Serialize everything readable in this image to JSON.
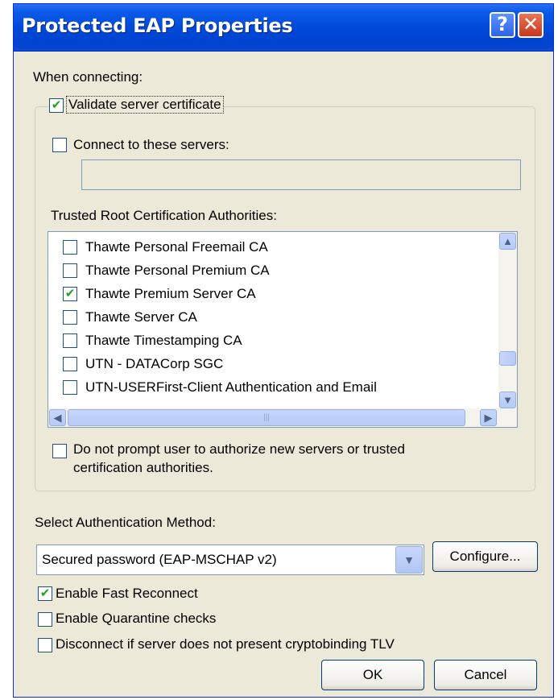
{
  "window": {
    "title": "Protected EAP Properties",
    "help_label": "?",
    "close_label": "✕"
  },
  "when_connecting": {
    "label": "When connecting:",
    "validate_cert": {
      "label": "Validate server certificate",
      "checked": true
    },
    "connect_servers": {
      "label": "Connect to these servers:",
      "checked": false,
      "value": ""
    },
    "trusted_label": "Trusted Root Certification Authorities:",
    "authorities": [
      {
        "name": "Thawte Personal Freemail CA",
        "checked": false
      },
      {
        "name": "Thawte Personal Premium CA",
        "checked": false
      },
      {
        "name": "Thawte Premium Server CA",
        "checked": true
      },
      {
        "name": "Thawte Server CA",
        "checked": false
      },
      {
        "name": "Thawte Timestamping CA",
        "checked": false
      },
      {
        "name": "UTN - DATACorp SGC",
        "checked": false
      },
      {
        "name": "UTN-USERFirst-Client Authentication and Email",
        "checked": false
      }
    ],
    "no_prompt": {
      "line1": "Do not prompt user to authorize new servers or trusted",
      "line2": "certification authorities.",
      "checked": false
    }
  },
  "auth": {
    "label": "Select Authentication Method:",
    "selected": "Secured password (EAP-MSCHAP v2)",
    "configure_label": "Configure..."
  },
  "options": {
    "fast_reconnect": {
      "label": "Enable Fast Reconnect",
      "checked": true
    },
    "quarantine": {
      "label": "Enable Quarantine checks",
      "checked": false
    },
    "cryptobinding": {
      "label": "Disconnect if server does not present cryptobinding TLV",
      "checked": false
    }
  },
  "buttons": {
    "ok": "OK",
    "cancel": "Cancel"
  },
  "glyphs": {
    "check": "✔",
    "up": "▲",
    "down": "▼",
    "left": "◀",
    "right": "▶",
    "grip": "|||"
  },
  "colors": {
    "titlebar": "#0054E3",
    "dialog_bg": "#ECE9D8",
    "checkmark": "#21A121",
    "close_button": "#D6472B"
  }
}
